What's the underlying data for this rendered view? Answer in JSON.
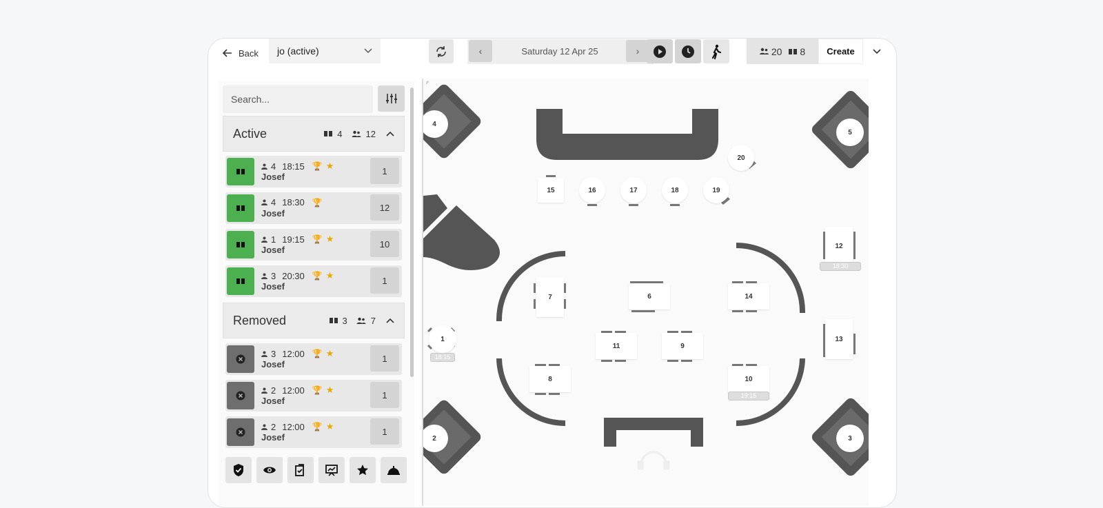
{
  "header": {
    "back_label": "Back",
    "service_selector": "jo (active)",
    "date": "Saturday 12 Apr 25",
    "prev_label": "‹",
    "next_label": "›",
    "guests_count": "20",
    "bookings_count": "8",
    "create_label": "Create"
  },
  "sidebar": {
    "search_placeholder": "Search...",
    "groups": [
      {
        "title": "Active",
        "bookings": "4",
        "guests": "12",
        "rows": [
          {
            "party": "4",
            "time": "18:15",
            "name": "Josef",
            "table": "1",
            "trophy": true,
            "star": true
          },
          {
            "party": "4",
            "time": "18:30",
            "name": "Josef",
            "table": "12",
            "trophy": true,
            "star": false
          },
          {
            "party": "1",
            "time": "19:15",
            "name": "Josef",
            "table": "10",
            "trophy": true,
            "star": true
          },
          {
            "party": "3",
            "time": "20:30",
            "name": "Josef",
            "table": "1",
            "trophy": true,
            "star": true
          }
        ]
      },
      {
        "title": "Removed",
        "bookings": "3",
        "guests": "7",
        "rows": [
          {
            "party": "3",
            "time": "12:00",
            "name": "Josef",
            "table": "1",
            "trophy": true,
            "star": true
          },
          {
            "party": "2",
            "time": "12:00",
            "name": "Josef",
            "table": "1",
            "trophy": true,
            "star": true
          },
          {
            "party": "2",
            "time": "12:00",
            "name": "Josef",
            "table": "1",
            "trophy": true,
            "star": true
          }
        ]
      }
    ],
    "tools": [
      "shield-check-icon",
      "eye-icon",
      "clipboard-check-icon",
      "chart-board-icon",
      "star-icon",
      "service-bell-icon"
    ]
  },
  "floor": {
    "tables": {
      "t1": "1",
      "t2": "2",
      "t3": "3",
      "t4": "4",
      "t5": "5",
      "t6": "6",
      "t7": "7",
      "t8": "8",
      "t9": "9",
      "t10": "10",
      "t11": "11",
      "t12": "12",
      "t13": "13",
      "t14": "14",
      "t15": "15",
      "t16": "16",
      "t17": "17",
      "t18": "18",
      "t19": "19",
      "t20": "20"
    },
    "labels": {
      "t1": "18:15",
      "t12": "18:30",
      "t10": "19:15"
    }
  },
  "colors": {
    "active_status": "#4caf50",
    "removed_status": "#6e6e6e",
    "furniture": "#555555",
    "accent_icon": "#e6ac00"
  }
}
